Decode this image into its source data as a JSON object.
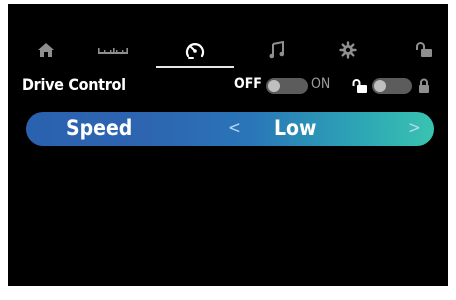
{
  "tabs": [
    {
      "id": "home",
      "icon": "home-icon"
    },
    {
      "id": "ruler",
      "icon": "ruler-icon"
    },
    {
      "id": "speedometer",
      "icon": "speedometer-icon",
      "active": true
    },
    {
      "id": "music",
      "icon": "music-icon"
    },
    {
      "id": "settings",
      "icon": "gear-icon"
    },
    {
      "id": "lock",
      "icon": "unlock-icon"
    }
  ],
  "drive_control": {
    "title": "Drive Control",
    "off_label": "OFF",
    "on_label": "ON",
    "toggle_state": "off",
    "lock_state": "unlocked"
  },
  "speed": {
    "label": "Speed",
    "prev_arrow": "<",
    "value": "Low",
    "next_arrow": ">"
  },
  "colors": {
    "background": "#000000",
    "icon": "#8f8f8f",
    "active_icon": "#ffffff",
    "speed_gradient_start": "#2a62b0",
    "speed_gradient_end": "#39c3b0"
  }
}
